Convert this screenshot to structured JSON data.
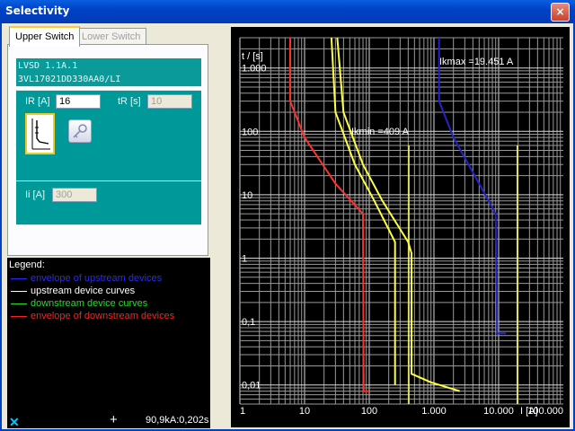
{
  "window": {
    "title": "Selectivity",
    "close_label": "×"
  },
  "tabs": [
    {
      "label": "Upper Switch",
      "active": true
    },
    {
      "label": "Lower Switch",
      "active": false
    }
  ],
  "device": {
    "name": "LVSD 1.1A.1",
    "order_number": "3VL17021DD330AA0/LI"
  },
  "settings": {
    "ir_label": "IR [A]",
    "ir_value": "16",
    "tr_label": "tR [s]",
    "tr_value": "10",
    "ii_label": "Ii [A]",
    "ii_value": "300"
  },
  "legend": {
    "title": "Legend:",
    "items": [
      {
        "label": "envelope of upstream devices",
        "color": "#2a2aff"
      },
      {
        "label": "upstream device curves",
        "color": "#ffffff"
      },
      {
        "label": "downstream device curves",
        "color": "#20e020"
      },
      {
        "label": "envelope of downstream devices",
        "color": "#ff2020"
      }
    ]
  },
  "status": {
    "cursor_value": "90,9kA:0,202s"
  },
  "chart_data": {
    "type": "line",
    "x_scale": "log",
    "y_scale": "log",
    "xlim": [
      1,
      100000
    ],
    "ylim": [
      0.005,
      3000
    ],
    "xlabel": "I [A]",
    "ylabel": "t / [s]",
    "x_ticks": [
      "1",
      "10",
      "100",
      "1.000",
      "10.000",
      "100.000"
    ],
    "y_ticks": [
      "1.000",
      "100",
      "10",
      "1",
      "0,1",
      "0,01"
    ],
    "grid": true,
    "annotations": [
      {
        "text": "Ikmax =19.451 A",
        "x": 19451
      },
      {
        "text": "Ikmin =409 A",
        "x": 409
      }
    ],
    "series": [
      {
        "color": "#2424c8",
        "points": [
          [
            1200,
            3000
          ],
          [
            1200,
            300
          ],
          [
            2000,
            80
          ],
          [
            5000,
            15
          ],
          [
            9000,
            5
          ],
          [
            9500,
            0.065
          ],
          [
            13000,
            0.065
          ]
        ]
      },
      {
        "color": "#ffff40",
        "points": [
          [
            26,
            3000
          ],
          [
            30,
            200
          ],
          [
            60,
            30
          ],
          [
            120,
            8
          ],
          [
            250,
            1.8
          ],
          [
            250,
            0.01
          ]
        ]
      },
      {
        "color": "#ffff40",
        "points": [
          [
            32,
            3000
          ],
          [
            40,
            200
          ],
          [
            80,
            30
          ],
          [
            160,
            8
          ],
          [
            400,
            1.8
          ],
          [
            450,
            1.2
          ],
          [
            450,
            0.015
          ],
          [
            900,
            0.011
          ],
          [
            2500,
            0.008
          ]
        ]
      },
      {
        "color": "#ff3030",
        "points": [
          [
            6,
            3000
          ],
          [
            6,
            300
          ],
          [
            10,
            80
          ],
          [
            30,
            15
          ],
          [
            80,
            5
          ],
          [
            82,
            0.008
          ],
          [
            100,
            0.008
          ]
        ]
      }
    ],
    "vlines": [
      {
        "x": 409,
        "color": "#ffff40"
      },
      {
        "x": 19451,
        "color": "#ffff40"
      }
    ]
  }
}
